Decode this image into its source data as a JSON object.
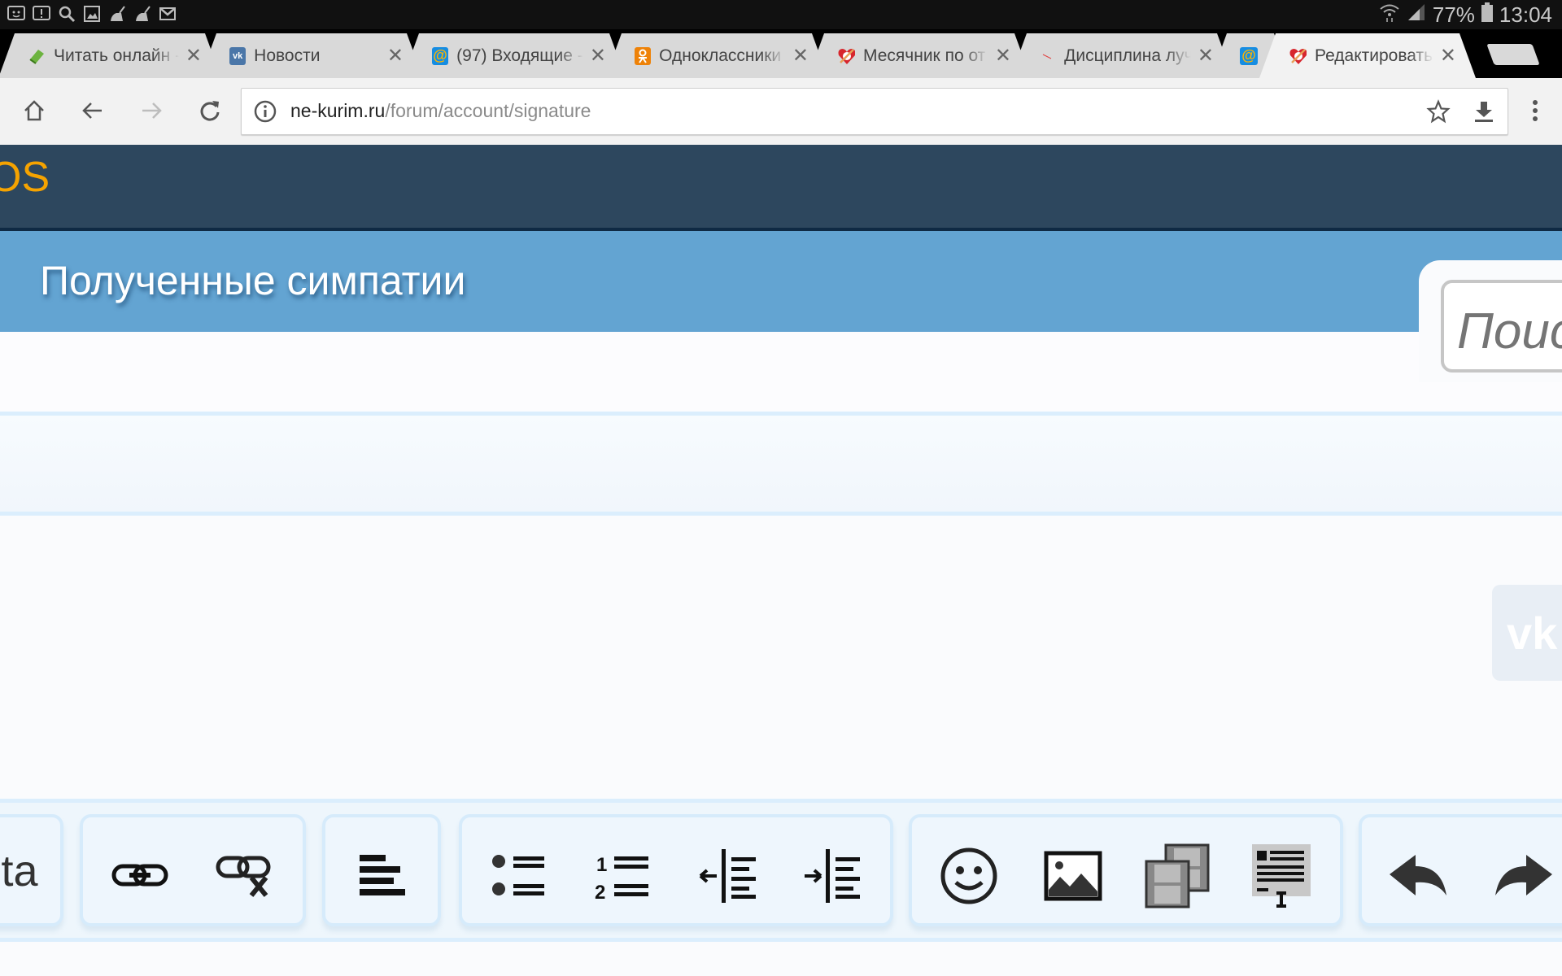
{
  "status_bar": {
    "notification_icons": [
      "messenger-icon",
      "alert-icon",
      "search-icon",
      "gallery-icon",
      "cleaner-icon",
      "cleaner-icon",
      "gmail-icon"
    ],
    "battery_percent": "77%",
    "time": "13:04"
  },
  "tabs": [
    {
      "title": "Читать онлайн -",
      "favicon": "book-icon",
      "color": "#6cb33f",
      "active": false
    },
    {
      "title": "Новости",
      "favicon": "vk-icon",
      "color": "#4a76a8",
      "active": false
    },
    {
      "title": "(97) Входящие -",
      "favicon": "mail-ru-icon",
      "color": "#168de2",
      "active": false
    },
    {
      "title": "Одноклассники",
      "favicon": "odnoklassniki-icon",
      "color": "#ee8208",
      "active": false
    },
    {
      "title": "Месячник по от",
      "favicon": "no-smoking-heart-icon",
      "color": "#d7262d",
      "active": false
    },
    {
      "title": "Дисциплина луч",
      "favicon": "dash-icon",
      "color": "#e04040",
      "active": false
    },
    {
      "title": "",
      "favicon": "mail-ru-icon",
      "color": "#168de2",
      "active": false
    },
    {
      "title": "Редактировать",
      "favicon": "no-smoking-heart-icon",
      "color": "#d7262d",
      "active": true
    }
  ],
  "toolbar": {
    "url_host": "ne-kurim.ru",
    "url_path": "/forum/account/signature"
  },
  "site": {
    "logo_fragment": "OS",
    "section_title": "Полученные симпатии",
    "search_placeholder": "Поиск"
  },
  "vk_widget": {
    "label": "vk"
  },
  "editor_toolbar": {
    "groups": [
      {
        "name": "font-group",
        "buttons": [
          "font-size-icon"
        ]
      },
      {
        "name": "link-group",
        "buttons": [
          "link-icon",
          "unlink-icon"
        ]
      },
      {
        "name": "align-group",
        "buttons": [
          "align-left-icon"
        ]
      },
      {
        "name": "list-group",
        "buttons": [
          "bullet-list-icon",
          "numbered-list-icon",
          "outdent-icon",
          "indent-icon"
        ]
      },
      {
        "name": "insert-group",
        "buttons": [
          "smilie-icon",
          "image-icon",
          "media-icon",
          "quote-icon"
        ]
      },
      {
        "name": "history-group",
        "buttons": [
          "undo-icon",
          "redo-icon"
        ]
      }
    ]
  },
  "colors": {
    "header_bg": "#2d475e",
    "logo_accent": "#f5a300",
    "title_bar": "#63a4d2"
  }
}
